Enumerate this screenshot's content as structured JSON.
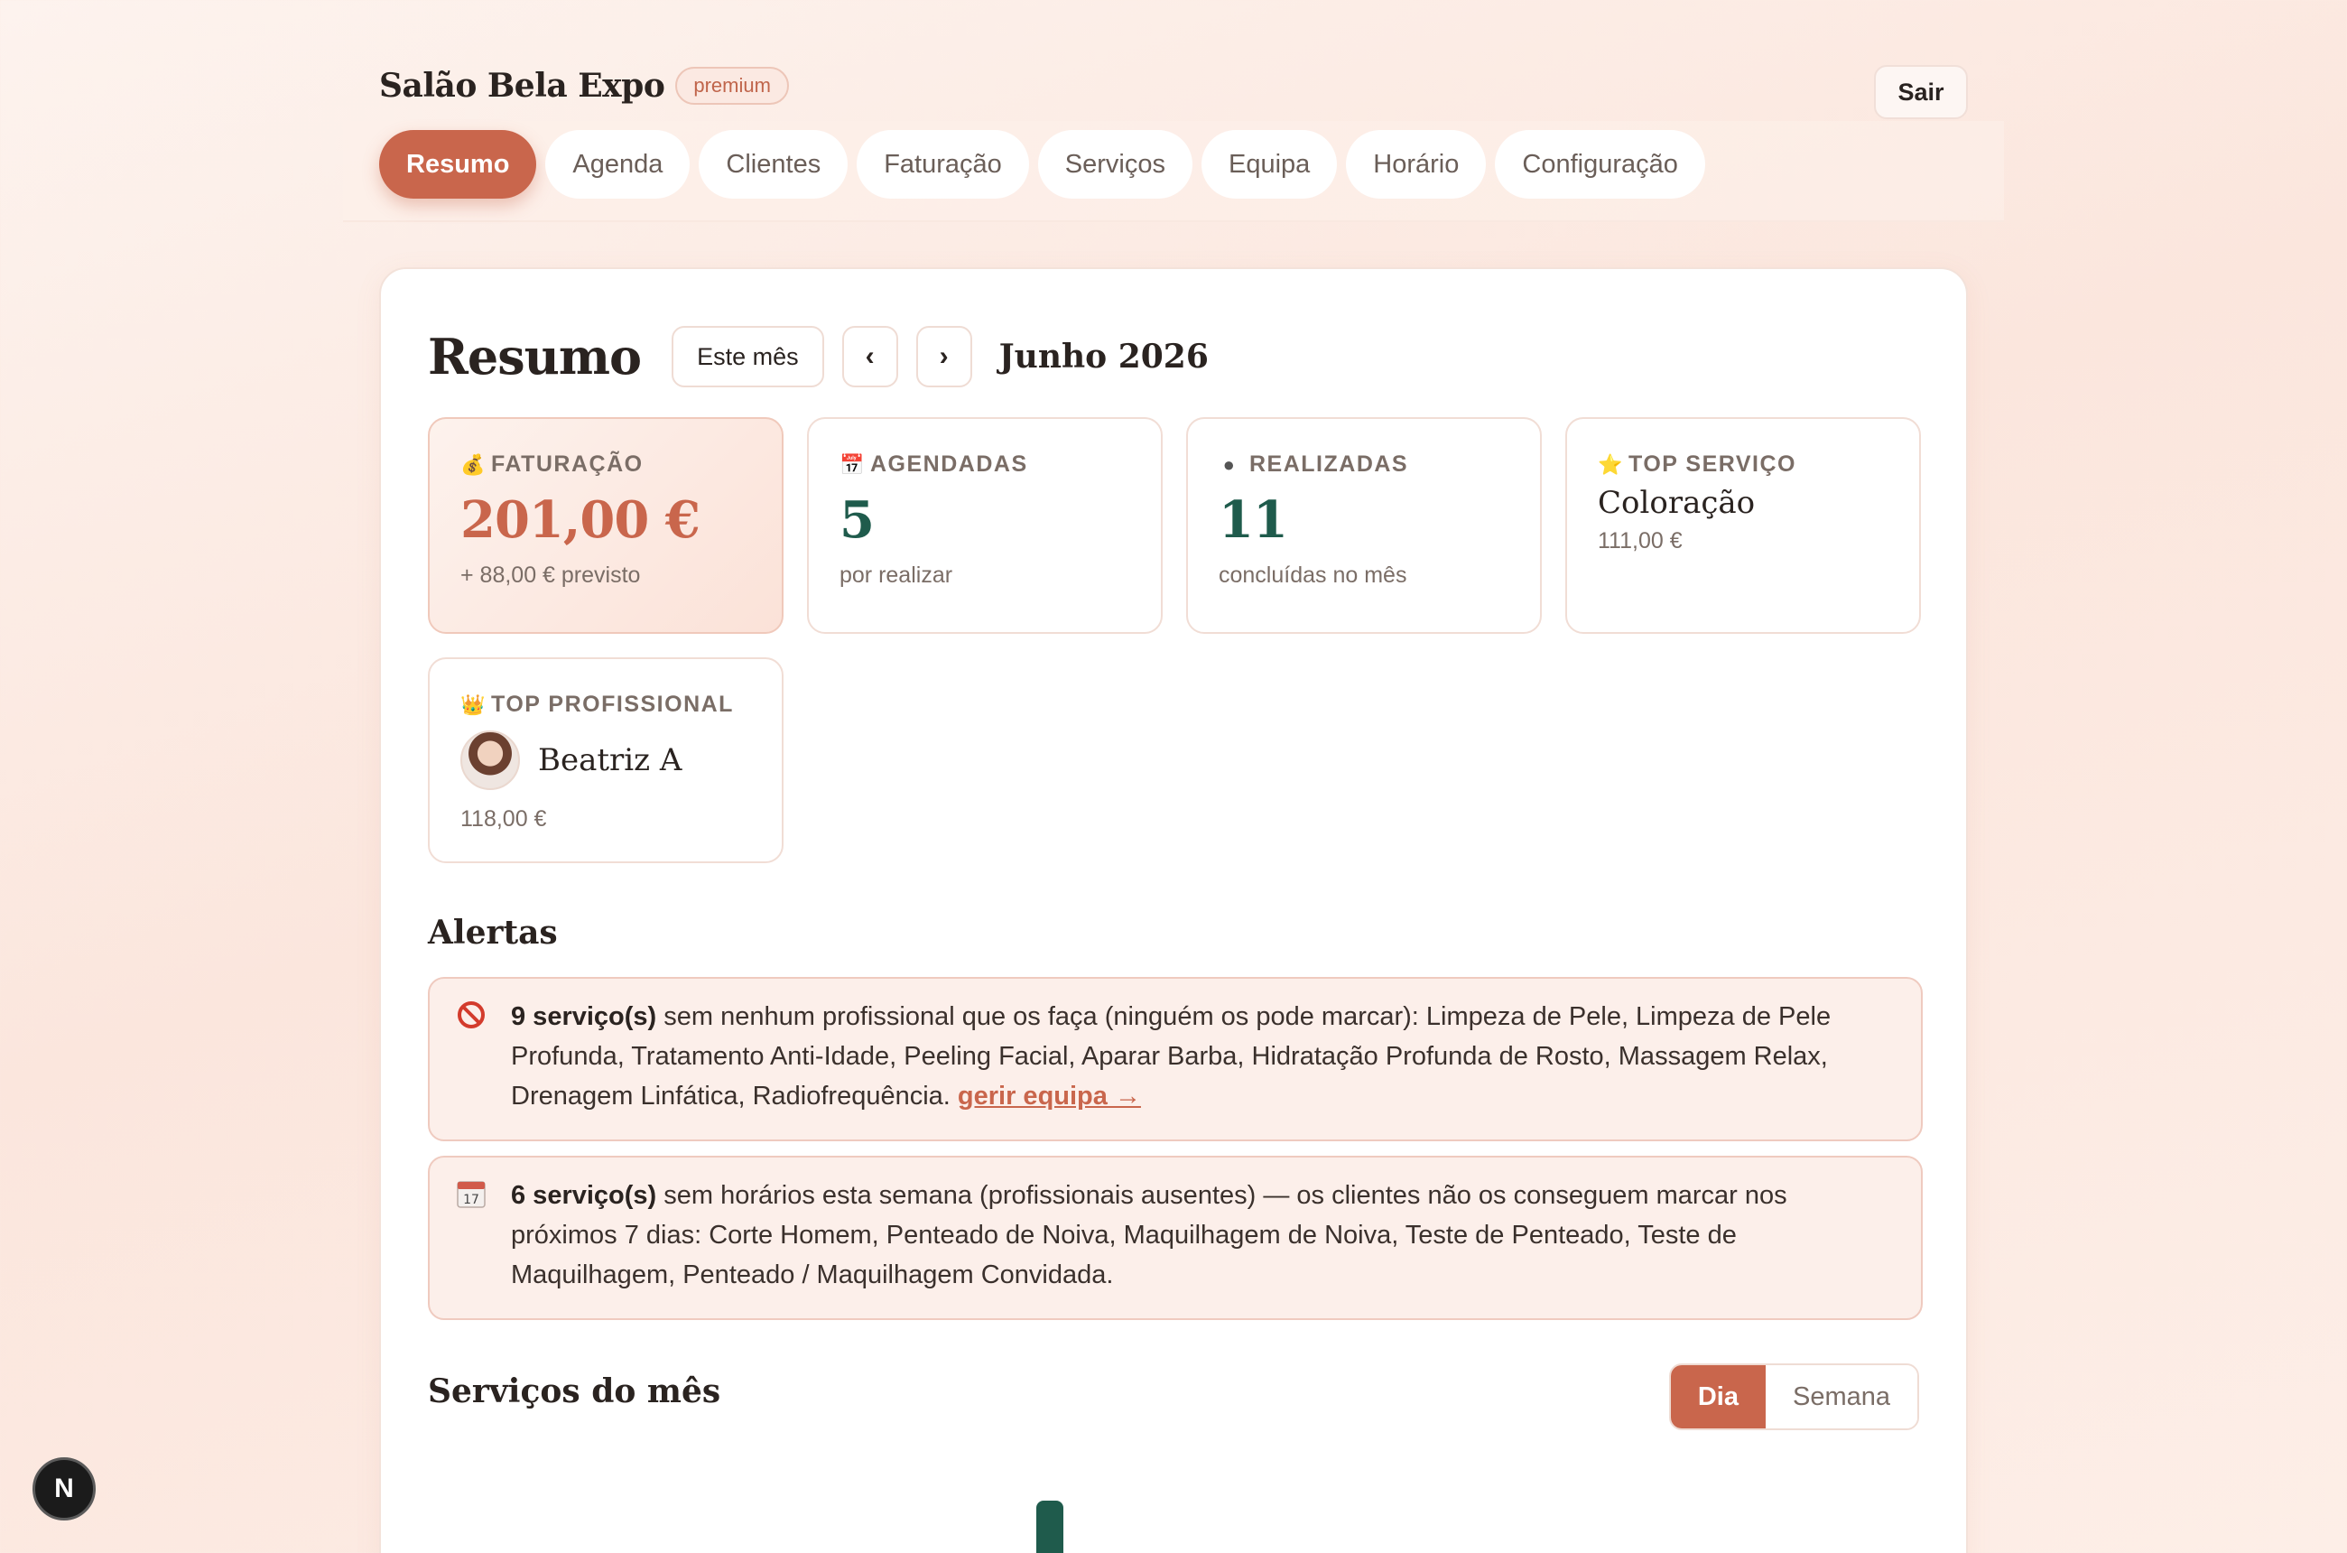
{
  "app": {
    "name": "Salão Bela Expo",
    "plan_badge": "premium",
    "logout_label": "Sair"
  },
  "nav": {
    "tabs": [
      {
        "label": "Resumo",
        "active": true
      },
      {
        "label": "Agenda"
      },
      {
        "label": "Clientes"
      },
      {
        "label": "Faturação"
      },
      {
        "label": "Serviços"
      },
      {
        "label": "Equipa"
      },
      {
        "label": "Horário"
      },
      {
        "label": "Configuração"
      }
    ]
  },
  "summary": {
    "title": "Resumo",
    "this_month_label": "Este mês",
    "prev_label": "‹",
    "next_label": "›",
    "period": "Junho 2026"
  },
  "stats": {
    "revenue": {
      "icon": "money-bag-icon",
      "glyph": "💰",
      "label": "FATURAÇÃO",
      "value": "201,00 €",
      "sub": "+ 88,00 € previsto"
    },
    "scheduled": {
      "icon": "calendar-icon",
      "glyph": "📅",
      "label": "AGENDADAS",
      "value": "5",
      "sub": "por realizar"
    },
    "done": {
      "icon": "circle-icon",
      "glyph": "●",
      "label": "REALIZADAS",
      "value": "11",
      "sub": "concluídas no mês"
    },
    "top_service": {
      "icon": "star-icon",
      "glyph": "⭐",
      "label": "TOP SERVIÇO",
      "name": "Coloração",
      "amount": "111,00 €"
    },
    "top_pro": {
      "icon": "crown-icon",
      "glyph": "👑",
      "label": "TOP PROFISSIONAL",
      "name": "Beatriz A",
      "amount": "118,00 €"
    }
  },
  "alerts": {
    "title": "Alertas",
    "items": [
      {
        "icon": "prohibited-icon",
        "bold": "9 serviço(s)",
        "text": " sem nenhum profissional que os faça (ninguém os pode marcar): Limpeza de Pele, Limpeza de Pele Profunda, Tratamento Anti-Idade, Peeling Facial, Aparar Barba, Hidratação Profunda de Rosto, Massagem Relax, Drenagem Linfática, Radiofrequência. ",
        "link": "gerir equipa →"
      },
      {
        "icon": "calendar-17-icon",
        "bold": "6 serviço(s)",
        "text": " sem horários esta semana (profissionais ausentes) — os clientes não os conseguem marcar nos próximos 7 dias: Corte Homem, Penteado de Noiva, Maquilhagem de Noiva, Teste de Penteado, Teste de Maquilhagem, Penteado / Maquilhagem Convidada."
      }
    ]
  },
  "services_chart": {
    "title": "Serviços do mês",
    "toggle": {
      "day": "Dia",
      "week": "Semana",
      "selected": "Dia"
    }
  },
  "dev_tools": {
    "label": "N"
  },
  "colors": {
    "accent": "#c9664c",
    "green": "#1f5b4c",
    "alert_bg": "#fcefea"
  }
}
